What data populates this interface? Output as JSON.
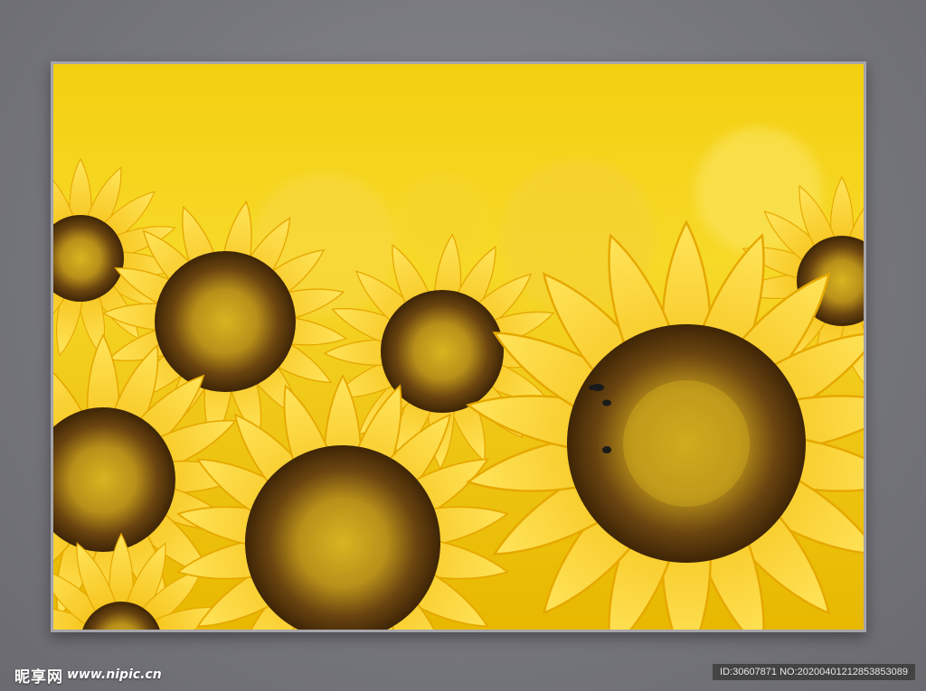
{
  "image": {
    "subject": "sunflowers",
    "colors": {
      "background_wall": "#75757c",
      "frame_border": "#a5a5aa",
      "petal": "#ffd21a",
      "petal_dark": "#f0b400",
      "center_outer": "#5a3a08",
      "center_inner": "#c9a41c",
      "sky_top": "#f7d616",
      "sky_glow": "#ffe46a"
    }
  },
  "watermark": {
    "brand": "昵享网",
    "url": "www.nipic.cn",
    "id_text": "ID:30607871 NO:20200401212853853089"
  }
}
